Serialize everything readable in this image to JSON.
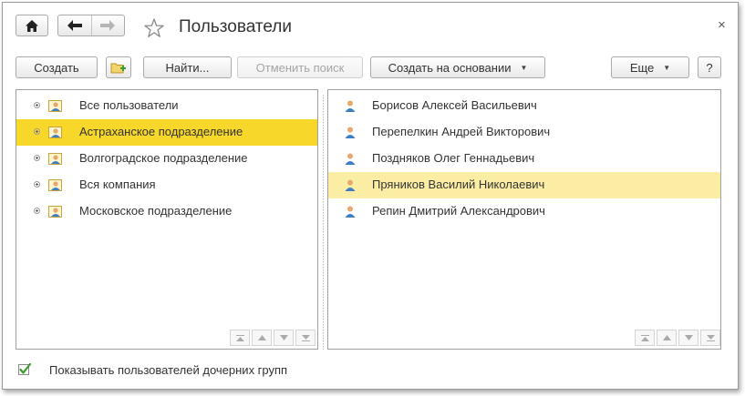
{
  "window": {
    "title": "Пользователи",
    "close_glyph": "×"
  },
  "toolbar": {
    "create_label": "Создать",
    "find_label": "Найти...",
    "cancel_search_label": "Отменить поиск",
    "create_based_label": "Создать на основании",
    "more_label": "Еще",
    "help_label": "?"
  },
  "groups": [
    {
      "label": "Все пользователи",
      "selected": false
    },
    {
      "label": "Астраханское подразделение",
      "selected": true
    },
    {
      "label": "Волгоградское подразделение",
      "selected": false
    },
    {
      "label": "Вся компания",
      "selected": false
    },
    {
      "label": "Московское подразделение",
      "selected": false
    }
  ],
  "users": [
    {
      "label": "Борисов Алексей Васильевич",
      "selected": false
    },
    {
      "label": "Перепелкин Андрей Викторович",
      "selected": false
    },
    {
      "label": "Поздняков Олег Геннадьевич",
      "selected": false
    },
    {
      "label": "Пряников Василий Николаевич",
      "selected": true
    },
    {
      "label": "Репин Дмитрий Александрович",
      "selected": false
    }
  ],
  "footer": {
    "show_child_groups_label": "Показывать пользователей дочерних групп",
    "show_child_groups_checked": true
  },
  "colors": {
    "selected_strong": "#f8d72b",
    "selected_light": "#fbeea4",
    "check_green": "#3c9a2e"
  },
  "icons": {
    "home": "home-icon",
    "back": "arrow-left-icon",
    "forward": "arrow-right-icon",
    "favorite": "star-icon",
    "new_folder": "folder-add-icon",
    "group": "user-group-icon",
    "user": "user-icon"
  }
}
